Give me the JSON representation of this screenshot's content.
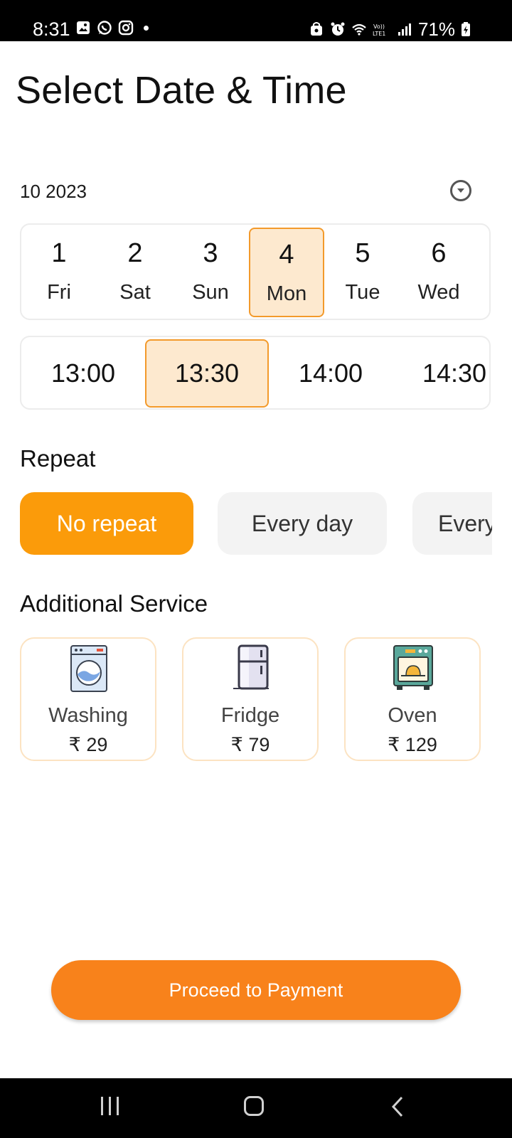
{
  "status_bar": {
    "time": "8:31",
    "battery": "71%",
    "left_icons": [
      "gallery-icon",
      "whatsapp-icon",
      "instagram-icon"
    ],
    "right_icons": [
      "vpn-icon",
      "alarm-icon",
      "wifi-icon",
      "volte-icon",
      "signal-icon",
      "battery-icon"
    ]
  },
  "page": {
    "title": "Select Date & Time"
  },
  "calendar": {
    "month_label": "10 2023",
    "dates": [
      {
        "num": "1",
        "day": "Fri"
      },
      {
        "num": "2",
        "day": "Sat"
      },
      {
        "num": "3",
        "day": "Sun"
      },
      {
        "num": "4",
        "day": "Mon"
      },
      {
        "num": "5",
        "day": "Tue"
      },
      {
        "num": "6",
        "day": "Wed"
      }
    ],
    "selected_date": "4"
  },
  "times": {
    "slots": [
      "13:00",
      "13:30",
      "14:00",
      "14:30"
    ],
    "selected": "13:30"
  },
  "repeat": {
    "title": "Repeat",
    "options": [
      "No repeat",
      "Every day",
      "Every"
    ],
    "selected": "No repeat"
  },
  "additional_service": {
    "title": "Additional Service",
    "items": [
      {
        "name": "Washing",
        "price": "₹ 29",
        "icon": "washing-machine-icon"
      },
      {
        "name": "Fridge",
        "price": "₹ 79",
        "icon": "fridge-icon"
      },
      {
        "name": "Oven",
        "price": "₹ 129",
        "icon": "oven-icon"
      }
    ]
  },
  "cta": {
    "label": "Proceed to Payment"
  },
  "colors": {
    "accent": "#fb9b0a",
    "button": "#f8821b",
    "selected_bg": "#fde9cf",
    "selected_border": "#f39a2b"
  }
}
